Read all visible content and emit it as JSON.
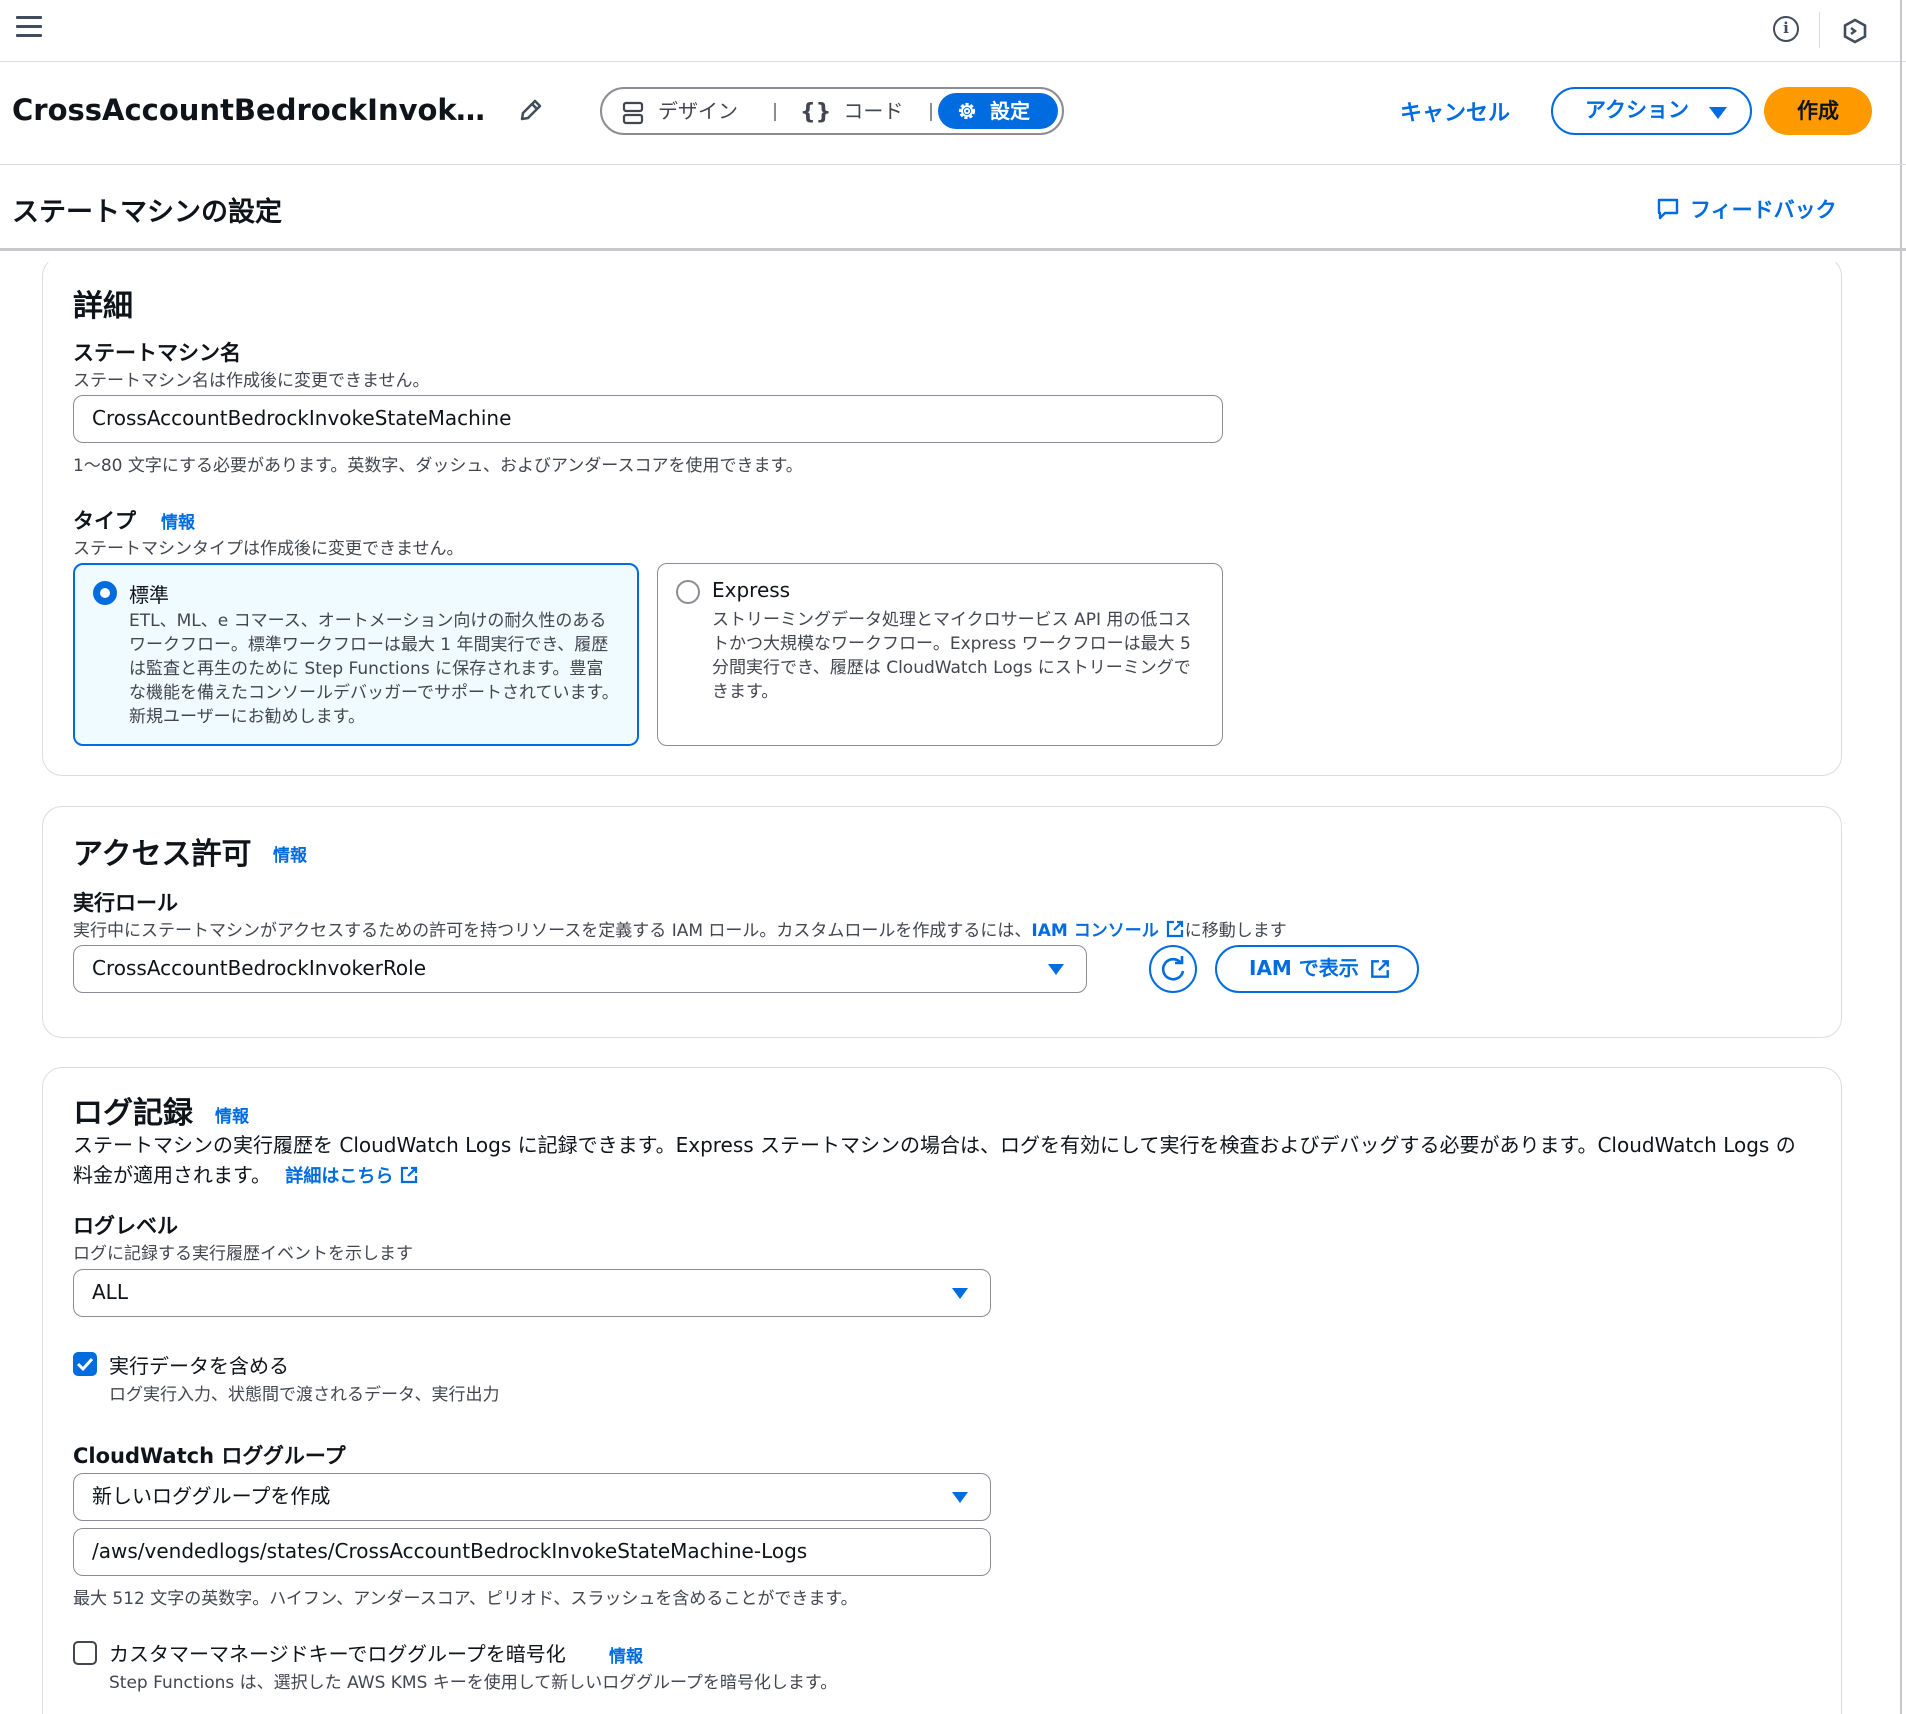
{
  "topbar": {
    "menu_icon": "hamburger-menu-icon",
    "info_icon": "info-icon",
    "hex_icon": "cloudshell-icon"
  },
  "header": {
    "title": "CrossAccountBedrockInvokeStateMachine",
    "tabs": [
      {
        "label": "デザイン",
        "icon": "design-icon"
      },
      {
        "label": "コード",
        "icon": "code-braces-icon"
      },
      {
        "label": "設定",
        "icon": "gear-icon",
        "active": true
      }
    ],
    "cancel_label": "キャンセル",
    "action_label": "アクション",
    "create_label": "作成"
  },
  "subheader": {
    "title": "ステートマシンの設定",
    "feedback_label": "フィードバック"
  },
  "details": {
    "heading": "詳細",
    "name_label": "ステートマシン名",
    "name_desc": "ステートマシン名は作成後に変更できません。",
    "name_value": "CrossAccountBedrockInvokeStateMachine",
    "name_constraint": "1〜80 文字にする必要があります。英数字、ダッシュ、およびアンダースコアを使用できます。",
    "type_label": "タイプ",
    "info": "情報",
    "type_desc": "ステートマシンタイプは作成後に変更できません。",
    "types": [
      {
        "title": "標準",
        "desc": "ETL、ML、e コマース、オートメーション向けの耐久性のあるワークフロー。標準ワークフローは最大 1 年間実行でき、履歴は監査と再生のために Step Functions に保存されます。豊富な機能を備えたコンソールデバッガーでサポートされています。新規ユーザーにお勧めします。",
        "selected": true
      },
      {
        "title": "Express",
        "desc": "ストリーミングデータ処理とマイクロサービス API 用の低コストかつ大規模なワークフロー。Express ワークフローは最大 5 分間実行でき、履歴は CloudWatch Logs にストリーミングできます。",
        "selected": false
      }
    ]
  },
  "access": {
    "heading": "アクセス許可",
    "info": "情報",
    "role_label": "実行ロール",
    "role_desc_prefix": "実行中にステートマシンがアクセスするための許可を持つリソースを定義する IAM ロール。カスタムロールを作成するには、",
    "role_desc_link": "IAM コンソール",
    "role_desc_suffix": "に移動します",
    "role_value": "CrossAccountBedrockInvokerRole",
    "view_iam_label": "IAM で表示"
  },
  "logging": {
    "heading": "ログ記録",
    "info": "情報",
    "desc": "ステートマシンの実行履歴を CloudWatch Logs に記録できます。Express ステートマシンの場合は、ログを有効にして実行を検査およびデバッグする必要があります。CloudWatch Logs の料金が適用されます。",
    "learn_more": "詳細はこちら",
    "level_label": "ログレベル",
    "level_desc": "ログに記録する実行履歴イベントを示します",
    "level_value": "ALL",
    "include_data_label": "実行データを含める",
    "include_data_desc": "ログ実行入力、状態間で渡されるデータ、実行出力",
    "include_data_checked": true,
    "group_label": "CloudWatch ロググループ",
    "group_select_value": "新しいロググループを作成",
    "group_name_value": "/aws/vendedlogs/states/CrossAccountBedrockInvokeStateMachine-Logs",
    "group_constraint": "最大 512 文字の英数字。ハイフン、アンダースコア、ピリオド、スラッシュを含めることができます。",
    "encrypt_label": "カスタマーマネージドキーでロググループを暗号化",
    "encrypt_desc": "Step Functions は、選択した AWS KMS キーを使用して新しいロググループを暗号化します。",
    "encrypt_checked": false
  },
  "colors": {
    "accent": "#006ce0",
    "create": "#ff9900",
    "selected_bg": "#f0fbff",
    "border": "#8c8c94"
  }
}
